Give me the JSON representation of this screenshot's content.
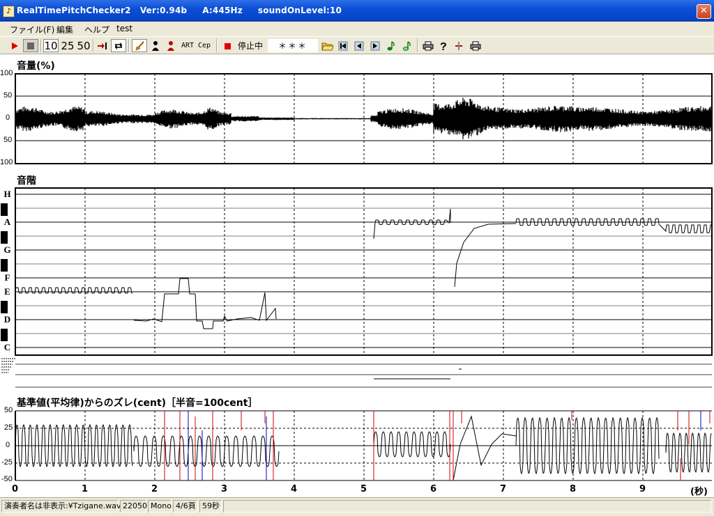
{
  "window": {
    "title": "RealTimePitchChecker2   Ver:0.94b     A:445Hz     soundOnLevel:10",
    "close_label": "✕"
  },
  "menu": [
    "ファイル(F)",
    "編集",
    "ヘルプ",
    "test"
  ],
  "toolbar": {
    "zoom_10": "10",
    "zoom_25": "25",
    "zoom_50": "50",
    "art_label": "ART",
    "cep_label": "Cep",
    "status_text": "停止中",
    "note_display": "＊＊＊"
  },
  "volume_panel": {
    "title": "音量(%)",
    "y_ticks": [
      "100",
      "50",
      "0",
      "50",
      "100"
    ]
  },
  "scale_panel": {
    "title": "音階",
    "notes": [
      "H",
      "A",
      "G",
      "F",
      "E",
      "D",
      "C"
    ]
  },
  "deviation_panel": {
    "title": "基準値(平均律)からのズレ(cent)［半音=100cent］",
    "y_ticks": [
      "50",
      "25",
      "0",
      "-25",
      "-50"
    ]
  },
  "time_axis": {
    "ticks": [
      "0",
      "1",
      "2",
      "3",
      "4",
      "5",
      "6",
      "7",
      "8",
      "9"
    ],
    "unit": "(秒)"
  },
  "statusbar": {
    "file": "演奏者名は非表示:¥Tzigane.wav",
    "sample_rate": "22050",
    "channels": "Mono",
    "page": "4/6頁",
    "duration": "59秒"
  },
  "colors": {
    "title_bar": "#0a4fd6",
    "chrome": "#ece9d8",
    "trace": "#000000",
    "marker_red": "#d00000",
    "marker_blue": "#0000c0"
  }
}
